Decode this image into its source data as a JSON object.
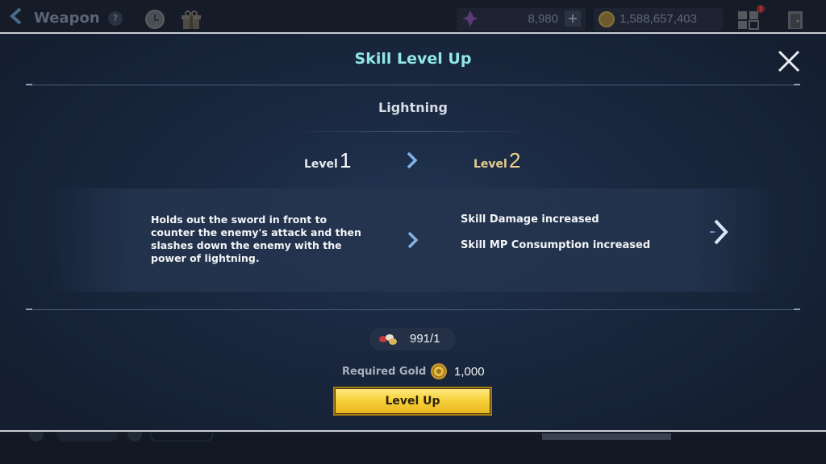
{
  "topbar": {
    "title": "Weapon",
    "help_label": "?",
    "gem_amount": "8,980",
    "plus_label": "+",
    "gold_amount": "1,588,657,403",
    "notification_count": "1"
  },
  "modal": {
    "title": "Skill Level Up",
    "skill_name": "Lightning",
    "current_level_label": "Level",
    "current_level_number": "1",
    "next_level_label": "Level",
    "next_level_number": "2",
    "current_description": "Holds out the sword in front to counter the enemy's attack and then slashes down the enemy with the power of lightning.",
    "changes": [
      "Skill Damage increased",
      "Skill MP Consumption increased"
    ],
    "material_count": "991/1",
    "required_gold_label": "Required Gold",
    "required_gold_amount": "1,000",
    "level_up_button": "Level Up"
  },
  "colors": {
    "title_accent": "#8fe8e6",
    "next_level_gold": "#f0d28a",
    "button_yellow": "#f7d23c"
  }
}
